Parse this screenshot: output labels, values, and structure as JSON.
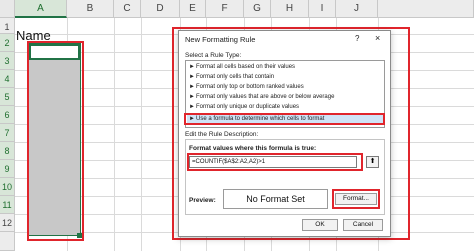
{
  "sheet": {
    "corner": "",
    "columns": [
      "A",
      "B",
      "C",
      "D",
      "E",
      "F",
      "G",
      "H",
      "I",
      "J"
    ],
    "rows": [
      "1",
      "2",
      "3",
      "4",
      "5",
      "6",
      "7",
      "8",
      "9",
      "10",
      "11",
      "12"
    ],
    "a1_value": "Name",
    "selection_color": "#c8c8c8",
    "accent_color": "#217346",
    "highlight_color": "#e0252c"
  },
  "dialog": {
    "title": "New Formatting Rule",
    "help": "?",
    "close": "×",
    "select_label": "Select a Rule Type:",
    "rule_types": [
      "Format all cells based on their values",
      "Format only cells that contain",
      "Format only top or bottom ranked values",
      "Format only values that are above or below average",
      "Format only unique or duplicate values",
      "Use a formula to determine which cells to format"
    ],
    "selected_index": 5,
    "desc_label": "Edit the Rule Description:",
    "formula_label": "Format values where this formula is true:",
    "formula_value": "=COUNTIF($A$2:A2,A2)>1",
    "preview_label": "Preview:",
    "preview_text": "No Format Set",
    "format_button": "Format...",
    "ok_button": "OK",
    "cancel_button": "Cancel"
  }
}
